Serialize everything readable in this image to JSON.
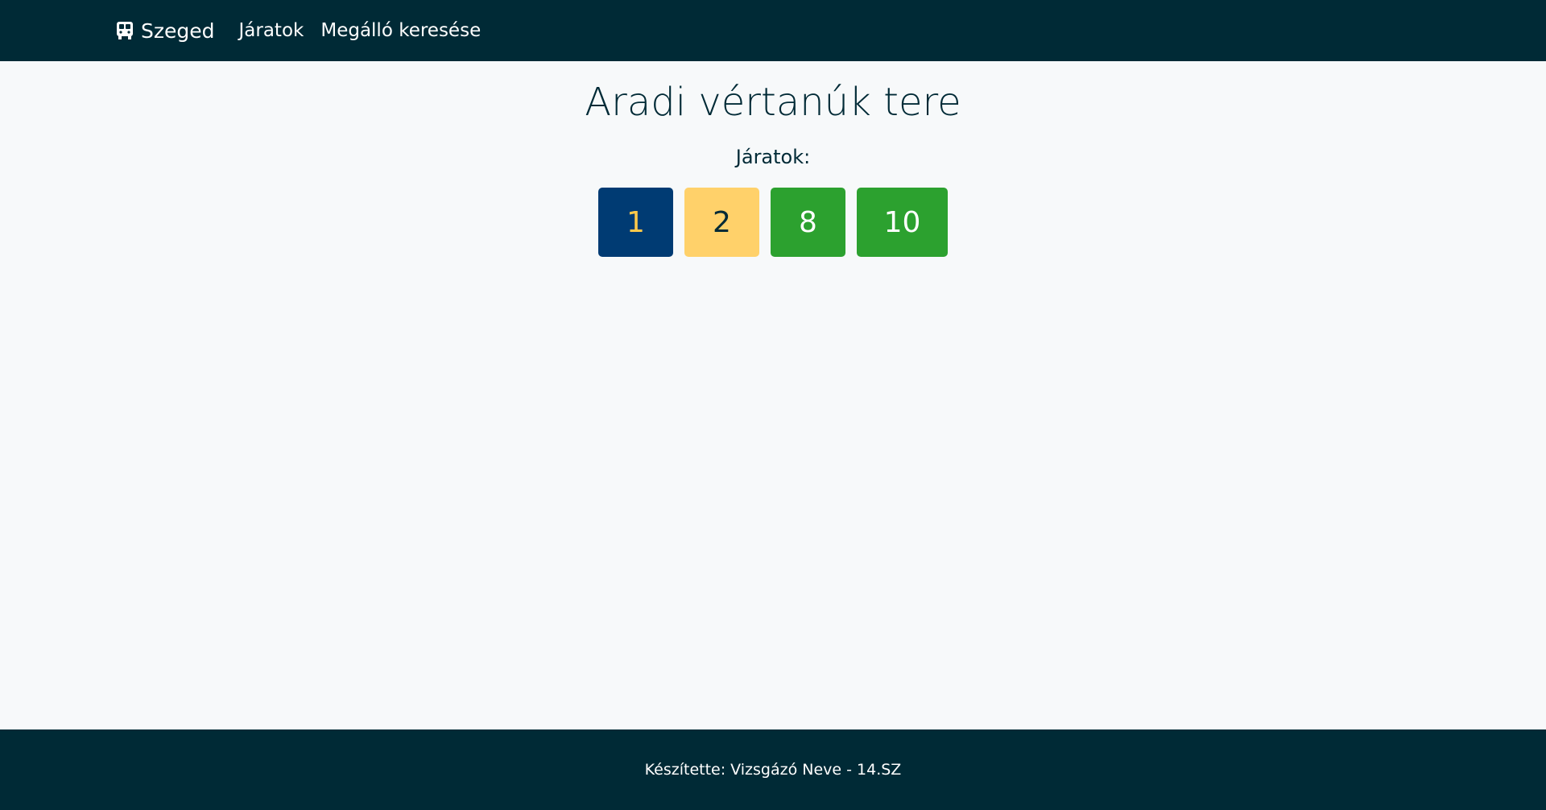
{
  "navbar": {
    "brand_label": "Szeged",
    "brand_icon": "bus-icon",
    "links": [
      {
        "label": "Járatok"
      },
      {
        "label": "Megálló keresése"
      }
    ]
  },
  "main": {
    "title": "Aradi vértanúk tere",
    "routes_label": "Járatok:",
    "routes": [
      {
        "number": "1",
        "bg_color": "#003b73",
        "text_color": "#ffc94a"
      },
      {
        "number": "2",
        "bg_color": "#ffd16a",
        "text_color": "#002a36"
      },
      {
        "number": "8",
        "bg_color": "#2ca12f",
        "text_color": "#ffffff"
      },
      {
        "number": "10",
        "bg_color": "#2ca12f",
        "text_color": "#ffffff"
      }
    ]
  },
  "footer": {
    "text": "Készítette: Vizsgázó Neve - 14.SZ"
  },
  "colors": {
    "navbar_bg": "#002a36",
    "page_bg": "#f7f9fa",
    "footer_bg": "#002a36"
  }
}
